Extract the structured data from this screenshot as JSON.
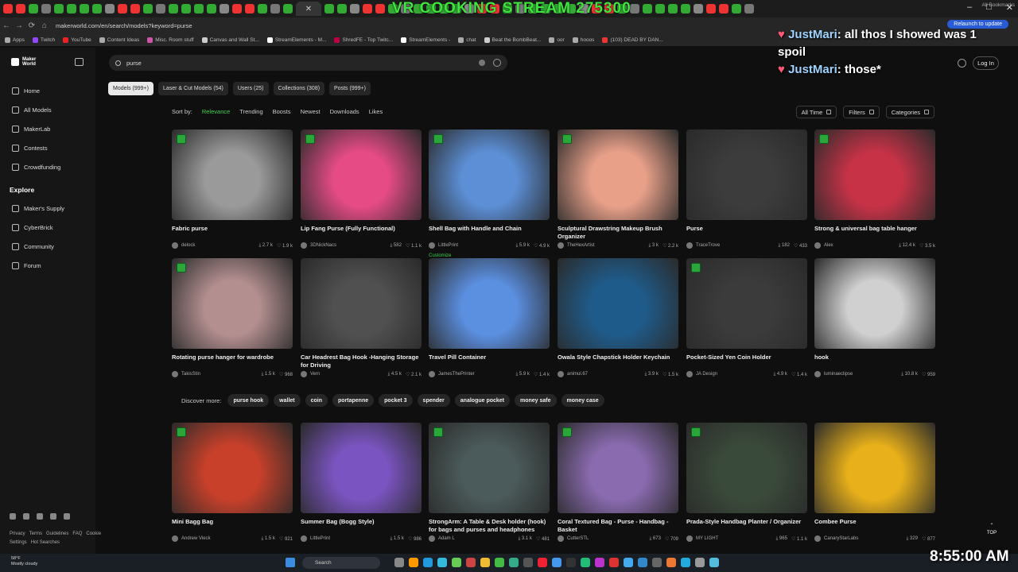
{
  "stream": {
    "title": "VR COOKING STREAM 275300",
    "clock": "8:55:00 AM"
  },
  "chat": [
    {
      "user": "JustMari",
      "text": "all thos I showed was 1"
    },
    {
      "user": "",
      "text": "spoil"
    },
    {
      "user": "JustMari",
      "text": "those*"
    }
  ],
  "browser": {
    "url": "makerworld.com/en/search/models?keyword=purse",
    "relaunch": "Relaunch to update",
    "bookmarks": [
      "Apps",
      "Twitch",
      "YouTube",
      "Content Ideas",
      "Misc. Room stuff",
      "Canvas and Wall St...",
      "StreamElements - M...",
      "ShredFE - Top Twitc...",
      "StreamElements -",
      "chat",
      "Beat the BombBeat...",
      "oor",
      "hooos",
      "(103) DEAD BY DAN..."
    ],
    "all_bookmarks": "All Bookmarks"
  },
  "sidebar": {
    "logo": [
      "Maker",
      "World"
    ],
    "items": [
      "Home",
      "All Models",
      "MakerLab",
      "Contests",
      "Crowdfunding"
    ],
    "explore_label": "Explore",
    "explore_items": [
      "Maker's Supply",
      "CyberBrick",
      "Community",
      "Forum"
    ],
    "footer": [
      "Privacy",
      "Terms",
      "Guidelines",
      "FAQ",
      "Cookie Settings",
      "Hot Searches"
    ]
  },
  "search": {
    "value": "purse",
    "login": "Log In"
  },
  "category_tabs": [
    "Models (999+)",
    "Laser & Cut Models (54)",
    "Users (25)",
    "Collections (308)",
    "Posts (999+)"
  ],
  "sort": {
    "label": "Sort by:",
    "options": [
      "Relevance",
      "Trending",
      "Boosts",
      "Newest",
      "Downloads",
      "Likes"
    ]
  },
  "filters": [
    "All Time",
    "Filters",
    "Categories"
  ],
  "models": [
    {
      "title": "Fabric purse",
      "author": "delock",
      "dl": "2.7 k",
      "likes": "1.9 k",
      "color": "#9a9a9a"
    },
    {
      "title": "Lip Fang Purse (Fully Functional)",
      "author": "3DNickNacs",
      "dl": "582",
      "likes": "1.1 k",
      "color": "#e64b86"
    },
    {
      "title": "Shell Bag with Handle and Chain",
      "author": "LittlePrint",
      "dl": "5.9 k",
      "likes": "4.9 k",
      "color": "#5c8fd6",
      "extra": "Customize"
    },
    {
      "title": "Sculptural Drawstring Makeup Brush Organizer",
      "author": "TheHexArtist",
      "dl": "3 k",
      "likes": "2.2 k",
      "color": "#e8a089"
    },
    {
      "title": "Purse",
      "author": "TraceTrove",
      "dl": "182",
      "likes": "433",
      "color": "#3c3c3c"
    },
    {
      "title": "Strong & universal bag table hanger",
      "author": "Alex",
      "dl": "12.4 k",
      "likes": "3.5 k",
      "color": "#c73247"
    },
    {
      "title": "Rotating purse hanger for wardrobe",
      "author": "TakisStin",
      "dl": "1.5 k",
      "likes": "968",
      "color": "#b48f90"
    },
    {
      "title": "Car Headrest Bag Hook -Hanging Storage for Driving",
      "author": "Vern",
      "dl": "4.5 k",
      "likes": "2.1 k",
      "color": "#505050"
    },
    {
      "title": "Travel Pill Container",
      "author": "JamesThePrinter",
      "dl": "5.9 k",
      "likes": "1.4 k",
      "color": "#5b8fe0"
    },
    {
      "title": "Owala Style Chapstick Holder Keychain",
      "author": "animul.67",
      "dl": "3.9 k",
      "likes": "1.5 k",
      "color": "#1f5b8a"
    },
    {
      "title": "Pocket-Sized Yen Coin Holder",
      "author": "JA Design",
      "dl": "4.9 k",
      "likes": "1.4 k",
      "color": "#3b3b3b"
    },
    {
      "title": "hook",
      "author": "luminaeclipse",
      "dl": "10.8 k",
      "likes": "959",
      "color": "#d0d0d0"
    },
    {
      "title": "Mini Bagg Bag",
      "author": "Andrew Vieck",
      "dl": "1.5 k",
      "likes": "921",
      "color": "#c8402a"
    },
    {
      "title": "Summer Bag (Bogg Style)",
      "author": "LittlePrint",
      "dl": "1.5 k",
      "likes": "986",
      "color": "#7a54c0"
    },
    {
      "title": "StrongArm: A Table & Desk holder (hook) for bags and purses and headphones",
      "author": "Adam L",
      "dl": "3.1 k",
      "likes": "481",
      "color": "#4b5a5a"
    },
    {
      "title": "Coral Textured Bag - Purse - Handbag - Basket",
      "author": "CutterSTL",
      "dl": "673",
      "likes": "709",
      "color": "#8a6bb0"
    },
    {
      "title": "Prada-Style Handbag Planter / Organizer",
      "author": "MY LIGHT",
      "dl": "965",
      "likes": "1.1 k",
      "color": "#3a4a3a"
    },
    {
      "title": "Combee Purse",
      "author": "CanaryStarLabs",
      "dl": "329",
      "likes": "877",
      "color": "#e8b01a"
    }
  ],
  "discover": {
    "label": "Discover more:",
    "chips": [
      "purse hook",
      "wallet",
      "coin",
      "portapenne",
      "pocket 3",
      "spender",
      "analogue pocket",
      "money safe",
      "money case"
    ]
  },
  "top_label": "TOP",
  "taskbar": {
    "weather_temp": "58°F",
    "weather_desc": "Mostly cloudy",
    "search": "Search"
  }
}
